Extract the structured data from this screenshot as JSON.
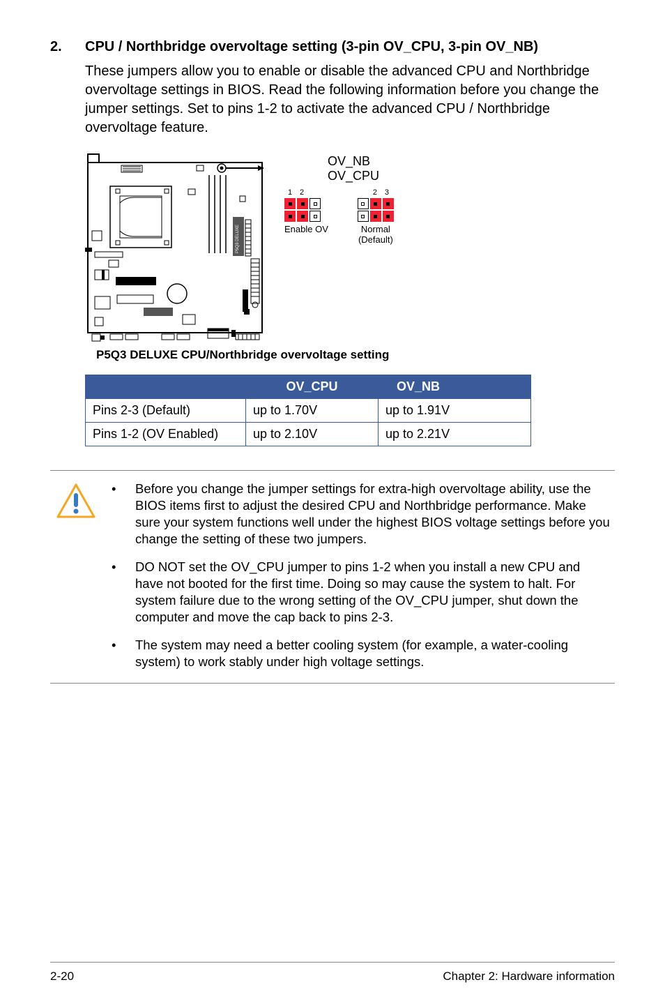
{
  "section": {
    "number": "2.",
    "title": "CPU / Northbridge overvoltage setting (3-pin OV_CPU, 3-pin OV_NB)",
    "body": "These jumpers allow you to enable or disable the advanced CPU and Northbridge overvoltage settings in BIOS. Read the following information before you change the jumper settings. Set to pins 1-2 to activate the advanced CPU / Northbridge overvoltage feature."
  },
  "diagram": {
    "label_nb": "OV_NB",
    "label_cpu": "OV_CPU",
    "left_pins": {
      "p1": "1",
      "p2": "2"
    },
    "right_pins": {
      "p2": "2",
      "p3": "3"
    },
    "left_caption": "Enable OV",
    "right_caption_line1": "Normal",
    "right_caption_line2": "(Default)",
    "board_label": "P5Q3 DELUXE",
    "caption": "P5Q3 DELUXE CPU/Northbridge overvoltage setting"
  },
  "table": {
    "headers": {
      "blank": "",
      "cpu": "OV_CPU",
      "nb": "OV_NB"
    },
    "rows": [
      {
        "setting": "Pins 2-3 (Default)",
        "cpu": "up to 1.70V",
        "nb": "up to 1.91V"
      },
      {
        "setting": "Pins 1-2 (OV Enabled)",
        "cpu": "up to 2.10V",
        "nb": "up to 2.21V"
      }
    ]
  },
  "notes": [
    "Before you change the jumper settings for extra-high overvoltage ability, use the BIOS items first to adjust the desired CPU and Northbridge performance. Make sure your system functions well under the highest BIOS voltage settings before you change the setting of these two jumpers.",
    "DO NOT set the OV_CPU jumper to pins 1-2 when you install a new CPU and have not booted for the first time. Doing so may cause the system to halt. For system failure due to the wrong setting of the OV_CPU jumper, shut down the computer and move the cap back to pins 2-3.",
    "The system may need a better cooling system (for example, a water-cooling system) to work stably under high voltage settings."
  ],
  "footer": {
    "left": "2-20",
    "right": "Chapter 2: Hardware information"
  }
}
